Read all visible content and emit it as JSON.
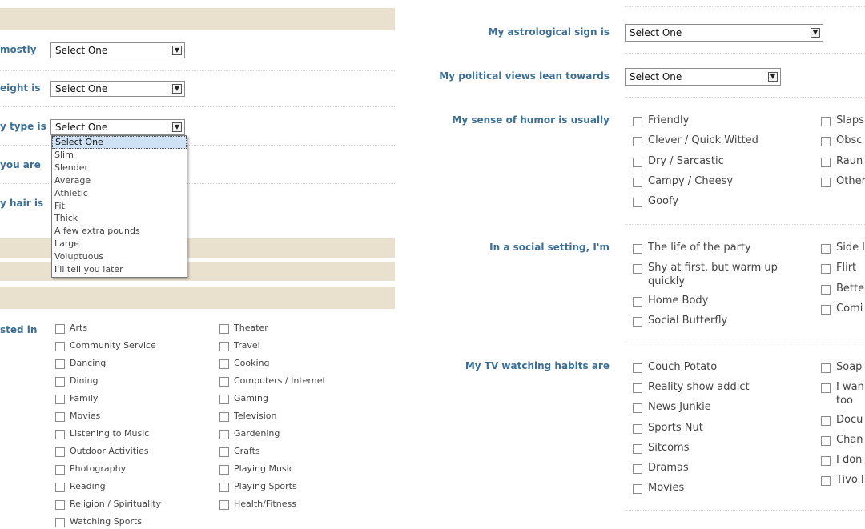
{
  "left_panel": {
    "mostly_label": "mostly",
    "height_label": "eight is",
    "body_type_label": "y type is",
    "you_are_label": "you are",
    "hair_label": "y hair is",
    "interested_label": "sted in",
    "mostly_value": "Select One",
    "height_value": "Select One",
    "body_type_value": "Select One",
    "body_type_options": [
      "Select One",
      "Slim",
      "Slender",
      "Average",
      "Athletic",
      "Fit",
      "Thick",
      "A few extra pounds",
      "Large",
      "Voluptuous",
      "I'll tell you later"
    ],
    "interests_col1": [
      "Arts",
      "Community Service",
      "Dancing",
      "Dining",
      "Family",
      "Movies",
      "Listening to Music",
      "Outdoor Activities",
      "Photography",
      "Reading",
      "Religion / Spirituality",
      "Watching Sports"
    ],
    "interests_col2": [
      "Theater",
      "Travel",
      "Cooking",
      "Computers / Internet",
      "Gaming",
      "Television",
      "Gardening",
      "Crafts",
      "Playing Music",
      "Playing Sports",
      "Health/Fitness"
    ]
  },
  "right_panel": {
    "astro_label": "My astrological sign is",
    "astro_value": "Select One",
    "politics_label": "My political views lean towards",
    "politics_value": "Select One",
    "humor_label": "My sense of humor is usually",
    "humor_col1": [
      "Friendly",
      "Clever / Quick Witted",
      "Dry / Sarcastic",
      "Campy / Cheesy",
      "Goofy"
    ],
    "humor_col2": [
      "Slaps",
      "Obsc",
      "Raun",
      "Other"
    ],
    "social_label": "In a social setting, I'm",
    "social_col1": [
      "The life of the party",
      "Shy at first, but warm up",
      "quickly",
      "Home Body",
      "Social Butterfly"
    ],
    "social_col2": [
      "Side l",
      "Flirt",
      "Bette",
      "Comi"
    ],
    "tv_label": "My TV watching habits are",
    "tv_col1": [
      "Couch Potato",
      "Reality show addict",
      "News Junkie",
      "Sports Nut",
      "Sitcoms",
      "Dramas",
      "Movies"
    ],
    "tv_col2": [
      "Soap",
      "I wan",
      "too",
      "Docu",
      "Chan",
      "I don",
      "Tivo l"
    ]
  },
  "icons": {
    "dropdown_arrow": "▼"
  }
}
